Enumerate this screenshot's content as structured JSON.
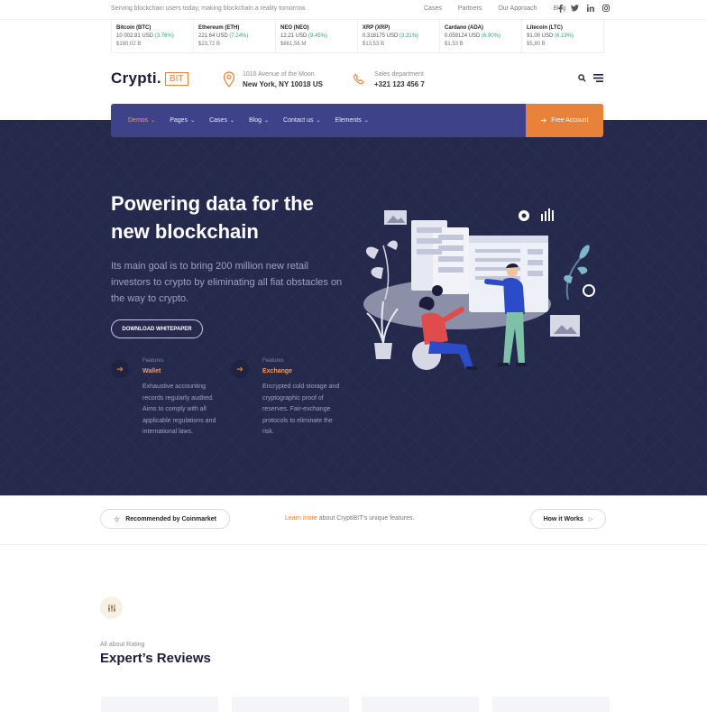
{
  "topbar": {
    "tagline": "Serving blockchain users today, making blockchain a reality tomorrow.",
    "links": [
      "Cases",
      "Partners",
      "Our Approach",
      "Blog"
    ],
    "social": [
      "facebook-icon",
      "twitter-icon",
      "linkedin-icon",
      "instagram-icon"
    ]
  },
  "ticker": [
    {
      "name": "Bitcoin (BTC)",
      "value": "10 002.91 USD",
      "change": "(3.76%)",
      "cap": "$180,02 B"
    },
    {
      "name": "Ethereum (ETH)",
      "value": "221.64 USD",
      "change": "(7.24%)",
      "cap": "$23,72 B"
    },
    {
      "name": "NEO (NEO)",
      "value": "12.21 USD",
      "change": "(9.45%)",
      "cap": "$861,56 M"
    },
    {
      "name": "XRP (XRP)",
      "value": "0.318175 USD",
      "change": "(3.31%)",
      "cap": "$13,53 B"
    },
    {
      "name": "Cardano (ADA)",
      "value": "0.059124 USD",
      "change": "(6.90%)",
      "cap": "$1,53 B"
    },
    {
      "name": "Litecoin (LTC)",
      "value": "91.00 USD",
      "change": "(6.19%)",
      "cap": "$5,80 B"
    }
  ],
  "header": {
    "logo_word": "Crypti.",
    "logo_box": "BIT",
    "address_line1": "1010 Avenue of the Moon",
    "address_line2": "New York, NY 10018 US",
    "phone_line1": "Sales department",
    "phone_line2": "+321 123 456 7"
  },
  "nav": {
    "items": [
      "Demos",
      "Pages",
      "Cases",
      "Blog",
      "Contact us",
      "Elements"
    ],
    "cta": "Free Account"
  },
  "hero": {
    "title_line1": "Powering data for the",
    "title_line2": "new blockchain",
    "subtitle": "Its main goal is to bring 200 million new retail investors to crypto by eliminating all fiat obstacles on the way to crypto.",
    "button": "DOWNLOAD WHITEPAPER",
    "features": [
      {
        "kicker": "Features",
        "title": "Wallet",
        "body": "Exhaustive accounting records regularly audited. Aims to comply with all applicable regulations and international laws."
      },
      {
        "kicker": "Features",
        "title": "Exchange",
        "body": "Encrypted cold storage and cryptographic proof of reserves. Fair-exchange protocols to eliminate the risk."
      }
    ]
  },
  "strip": {
    "recommended": "Recommended by Coinmarket",
    "learn_link": "Learn more",
    "learn_rest": " about CryptiBIT’s unique features.",
    "how": "How it Works"
  },
  "reviews": {
    "kicker": "All about Rating",
    "title": "Expert’s Reviews"
  },
  "colors": {
    "accent": "#e8823a",
    "nav": "#3e4389",
    "hero": "#252a4d",
    "positive": "#2ba776"
  }
}
